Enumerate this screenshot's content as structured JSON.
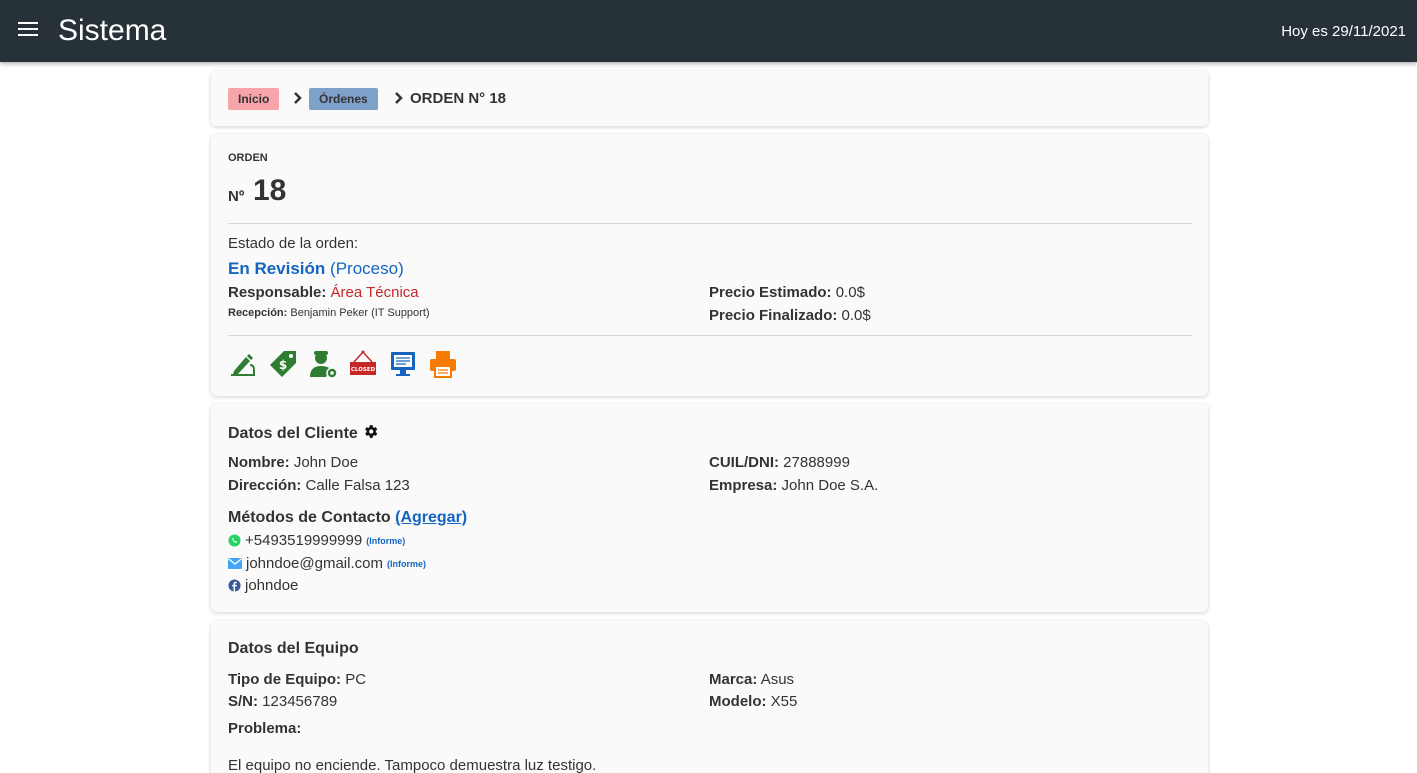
{
  "header": {
    "app_title": "Sistema",
    "date_text": "Hoy es 29/11/2021"
  },
  "breadcrumb": {
    "inicio": "Inicio",
    "ordenes": "Órdenes",
    "current": "ORDEN N° 18"
  },
  "order": {
    "label": "ORDEN",
    "number_prefix": "Nº",
    "number": "18",
    "estado_label": "Estado de la orden:",
    "estado_value": "En Revisión",
    "estado_phase": "(Proceso)",
    "responsable_label": "Responsable:",
    "responsable_value": "Área Técnica",
    "recepcion_label": "Recepción:",
    "recepcion_value": "Benjamin Peker (IT Support)",
    "precio_estimado_label": "Precio Estimado:",
    "precio_estimado_value": "0.0$",
    "precio_finalizado_label": "Precio Finalizado:",
    "precio_finalizado_value": "0.0$",
    "actions": [
      {
        "name": "sign-icon",
        "color": "#2e7d32"
      },
      {
        "name": "price-tag-icon",
        "color": "#2e7d32"
      },
      {
        "name": "technician-icon",
        "color": "#2e7d32"
      },
      {
        "name": "closed-sign-icon",
        "color": "#c62828"
      },
      {
        "name": "monitor-report-icon",
        "color": "#1565c0"
      },
      {
        "name": "printer-icon",
        "color": "#f57c00"
      }
    ]
  },
  "client": {
    "title": "Datos del Cliente",
    "nombre_label": "Nombre:",
    "nombre_value": "John Doe",
    "direccion_label": "Dirección:",
    "direccion_value": "Calle Falsa 123",
    "cuil_label": "CUIL/DNI:",
    "cuil_value": "27888999",
    "empresa_label": "Empresa:",
    "empresa_value": "John Doe S.A.",
    "contact_title": "Métodos de Contacto",
    "contact_add": "(Agregar)",
    "contacts": [
      {
        "icon": "whatsapp-icon",
        "value": "+5493519999999",
        "tag": "(Informe)"
      },
      {
        "icon": "mail-icon",
        "value": "johndoe@gmail.com",
        "tag": "(Informe)"
      },
      {
        "icon": "facebook-icon",
        "value": "johndoe",
        "tag": ""
      }
    ]
  },
  "equipo": {
    "title": "Datos del Equipo",
    "tipo_label": "Tipo de Equipo:",
    "tipo_value": "PC",
    "sn_label": "S/N:",
    "sn_value": "123456789",
    "marca_label": "Marca:",
    "marca_value": "Asus",
    "modelo_label": "Modelo:",
    "modelo_value": "X55",
    "problema_label": "Problema:",
    "problema_value": "El equipo no enciende. Tampoco demuestra luz testigo."
  }
}
